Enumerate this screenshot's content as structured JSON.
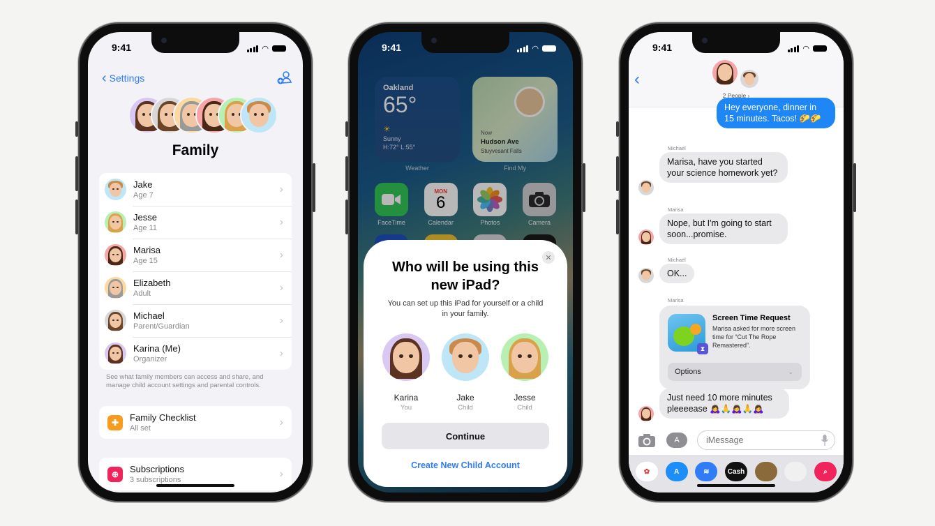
{
  "colors": {
    "accent": "#2f7cf6",
    "imessage_blue": "#1f87f5",
    "bubble_gray": "#e9e9eb",
    "settings_bg": "#f2f2f7"
  },
  "phone_family": {
    "status": {
      "time": "9:41"
    },
    "nav": {
      "back_label": "Settings",
      "add_member_icon": "person-add-icon"
    },
    "title": "Family",
    "header_avatars": [
      {
        "name": "Karina",
        "bg": "#d9c8f2",
        "hair": "#5b3320"
      },
      {
        "name": "Michael",
        "bg": "#d8d8d8",
        "hair": "#6a4527"
      },
      {
        "name": "Elizabeth",
        "bg": "#fbd9a0",
        "hair": "#9a9a9a"
      },
      {
        "name": "Marisa",
        "bg": "#f6a6a6",
        "hair": "#4a2818"
      },
      {
        "name": "Jesse",
        "bg": "#b8efb3",
        "hair": "#d9a24a"
      },
      {
        "name": "Jake",
        "bg": "#bfe6f7",
        "hair": "#c98a4b"
      }
    ],
    "members": [
      {
        "name": "Jake",
        "detail": "Age 7",
        "bg": "#bfe6f7",
        "hair": "#c98a4b"
      },
      {
        "name": "Jesse",
        "detail": "Age 11",
        "bg": "#b8efb3",
        "hair": "#d9a24a"
      },
      {
        "name": "Marisa",
        "detail": "Age 15",
        "bg": "#f6a6a6",
        "hair": "#4a2818"
      },
      {
        "name": "Elizabeth",
        "detail": "Adult",
        "bg": "#fbd9a0",
        "hair": "#9a9a9a"
      },
      {
        "name": "Michael",
        "detail": "Parent/Guardian",
        "bg": "#d8d8d8",
        "hair": "#6a4527"
      },
      {
        "name": "Karina (Me)",
        "detail": "Organizer",
        "bg": "#d9c8f2",
        "hair": "#5b3320"
      }
    ],
    "footnote": "See what family members can access and share, and manage child account settings and parental controls.",
    "checklist": {
      "title": "Family Checklist",
      "detail": "All set",
      "icon_color": "#f79a1e"
    },
    "subscriptions": {
      "title": "Subscriptions",
      "detail": "3 subscriptions",
      "icon_color": "#f0245a"
    }
  },
  "phone_setup": {
    "status": {
      "time": "9:41"
    },
    "weather_widget": {
      "city": "Oakland",
      "temp": "65°",
      "condition": "Sunny",
      "range": "H:72° L:55°",
      "label": "Weather"
    },
    "findmy_widget": {
      "time": "Now",
      "street": "Hudson Ave",
      "area": "Stuyvesant Falls",
      "label": "Find My"
    },
    "apps": [
      {
        "label": "FaceTime",
        "color": "#34c759"
      },
      {
        "label": "Calendar",
        "color": "#ffffff",
        "day": "MON",
        "date": "6"
      },
      {
        "label": "Photos",
        "color": "#ffffff"
      },
      {
        "label": "Camera",
        "color": "#d1d1d6"
      }
    ],
    "sheet": {
      "title": "Who will be using this new iPad?",
      "description": "You can set up this iPad for yourself or a child in your family.",
      "people": [
        {
          "name": "Karina",
          "role": "You",
          "bg": "#d9c8f2",
          "hair": "#5b3320"
        },
        {
          "name": "Jake",
          "role": "Child",
          "bg": "#bfe6f7",
          "hair": "#c98a4b"
        },
        {
          "name": "Jesse",
          "role": "Child",
          "bg": "#b8efb3",
          "hair": "#d9a24a"
        }
      ],
      "continue_label": "Continue",
      "create_child_label": "Create New Child Account",
      "close_glyph": "✕"
    }
  },
  "phone_messages": {
    "status": {
      "time": "9:41"
    },
    "header": {
      "people_count": "2 People ›"
    },
    "messages": [
      {
        "from": "me",
        "text": "Hey everyone, dinner in 15 minutes. Tacos! 🌮🌮"
      },
      {
        "from": "Michael",
        "text": "Marisa, have you started your science homework yet?"
      },
      {
        "from": "Marisa",
        "text": "Nope, but I'm going to start soon...promise."
      },
      {
        "from": "Michael",
        "text": "OK..."
      },
      {
        "from": "Marisa",
        "text": "Just need 10 more minutes pleeeease 🙇‍♀️🙏🙇‍♀️🙏🙇‍♀️"
      }
    ],
    "screen_time_request": {
      "sender": "Marisa",
      "title": "Screen Time Request",
      "body": "Marisa asked for more screen time for “Cut The Rope Remastered”.",
      "options_label": "Options"
    },
    "compose": {
      "placeholder": "iMessage"
    },
    "app_tray": [
      {
        "name": "photos-app",
        "label": "",
        "color": "#ffffff"
      },
      {
        "name": "app-store",
        "label": "A",
        "color": "#1c8ef9"
      },
      {
        "name": "audio-message",
        "label": "≋",
        "color": "#2f7cf6"
      },
      {
        "name": "apple-cash",
        "label": "Cash",
        "color": "#111111"
      },
      {
        "name": "memoji",
        "label": "",
        "color": "#8a6a3a"
      },
      {
        "name": "memoji-stickers",
        "label": "",
        "color": "#f0f0f0"
      },
      {
        "name": "images-search",
        "label": "⌕",
        "color": "#f0245a"
      }
    ]
  }
}
